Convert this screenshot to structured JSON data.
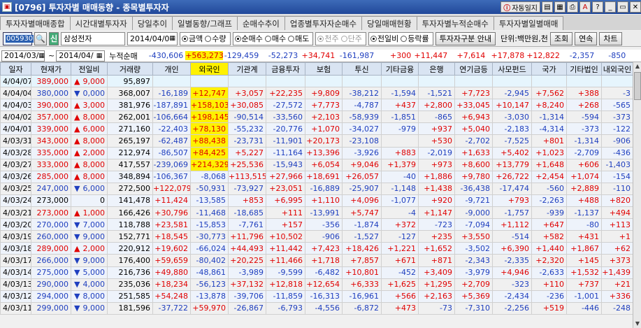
{
  "window": {
    "code": "[0796]",
    "title": "투자자별 매매동향 - 종목별투자자",
    "auto_log": "자동일지",
    "help": "?"
  },
  "tabs": [
    "투자자별매매종합",
    "시간대별투자자",
    "당일추이",
    "일별동향/그래프",
    "순매수추이",
    "업종별투자자순매수",
    "당일매매현황",
    "투자자별누적순매수",
    "투자자별일별매매"
  ],
  "toolbar": {
    "code": "005930",
    "stock_name": "삼성전자",
    "date": "2014/04/0",
    "r_amount": "금액",
    "r_qty": "수량",
    "r_net": "순매수",
    "r_buy": "매수",
    "r_sell": "매도",
    "r_thousand": "천주",
    "r_unit": "단주",
    "r_prevday": "전일비",
    "r_rate": "등락률",
    "investor_btn": "투자자구분 안내",
    "unit_label": "단위:백만원,천",
    "query": "조회",
    "next": "연속",
    "chart": "차트"
  },
  "summary": {
    "from": "2014/03/",
    "to": "2014/04/",
    "label": "누적순매",
    "values": [
      "-430,606",
      "+563,273",
      "-129,459",
      "-52,273",
      "+34,741",
      "-161,987",
      "+300",
      "+11,447",
      "+7,614",
      "+17,878",
      "+12,822",
      "-2,357",
      "-850"
    ]
  },
  "columns": [
    "일자",
    "현재가",
    "전일비",
    "거래량",
    "개인",
    "외국인",
    "기관계",
    "금융투자",
    "보험",
    "투신",
    "기타금융",
    "은행",
    "연기금등",
    "사모펀드",
    "국가",
    "기타법인",
    "내외국인"
  ],
  "rows": [
    [
      "4/04/07",
      "389,000",
      "9,000",
      "95,897",
      "",
      "",
      "",
      "",
      "",
      "",
      "",
      "",
      "",
      "",
      "",
      "",
      ""
    ],
    [
      "4/04/04",
      "380,000",
      "0,000",
      "368,007",
      "-16,189",
      "+12,747",
      "+3,057",
      "+22,235",
      "+9,809",
      "-38,212",
      "-1,594",
      "-1,521",
      "+7,723",
      "-2,945",
      "+7,562",
      "+388",
      "-3"
    ],
    [
      "4/04/03",
      "390,000",
      "3,000",
      "381,976",
      "-187,891",
      "+158,103",
      "+30,085",
      "-27,572",
      "+7,773",
      "-4,787",
      "+437",
      "+2,800",
      "+33,045",
      "+10,147",
      "+8,240",
      "+268",
      "-565"
    ],
    [
      "4/04/02",
      "357,000",
      "8,000",
      "262,001",
      "-106,664",
      "+198,145",
      "-90,514",
      "-33,560",
      "+2,103",
      "-58,939",
      "-1,851",
      "-865",
      "+6,943",
      "-3,030",
      "-1,314",
      "-594",
      "-373"
    ],
    [
      "4/04/01",
      "339,000",
      "6,000",
      "271,160",
      "-22,403",
      "+78,130",
      "-55,232",
      "-20,776",
      "+1,070",
      "-34,027",
      "-979",
      "+937",
      "+5,040",
      "-2,183",
      "-4,314",
      "-373",
      "-122"
    ],
    [
      "4/03/31",
      "343,000",
      "8,000",
      "265,197",
      "-62,487",
      "+88,438",
      "-23,731",
      "-11,901",
      "+20,173",
      "-23,108",
      "",
      "+530",
      "-2,702",
      "-7,525",
      "+801",
      "-1,314",
      "-906"
    ],
    [
      "4/03/28",
      "335,000",
      "2,000",
      "212,974",
      "-86,507",
      "+84,425",
      "+5,227",
      "-11,164",
      "+13,396",
      "-3,926",
      "+883",
      "-2,019",
      "+1,633",
      "+5,402",
      "+1,023",
      "-2,709",
      "-436"
    ],
    [
      "4/03/27",
      "333,000",
      "8,000",
      "417,557",
      "-239,069",
      "+214,329",
      "+25,536",
      "-15,943",
      "+6,054",
      "+9,046",
      "+1,379",
      "+973",
      "+8,600",
      "+13,779",
      "+1,648",
      "+606",
      "-1,403"
    ],
    [
      "4/03/26",
      "285,000",
      "8,000",
      "348,894",
      "-106,367",
      "-8,068",
      "+113,515",
      "+27,966",
      "+18,691",
      "+26,057",
      "-40",
      "+1,886",
      "+9,780",
      "+26,722",
      "+2,454",
      "+1,074",
      "-154"
    ],
    [
      "4/03/25",
      "247,000",
      "6,000",
      "272,500",
      "+122,079",
      "-50,931",
      "-73,927",
      "+23,051",
      "-16,889",
      "-25,907",
      "-1,148",
      "+1,438",
      "-36,438",
      "-17,474",
      "-560",
      "+2,889",
      "-110"
    ],
    [
      "4/03/24",
      "273,000",
      "0",
      "141,478",
      "+11,424",
      "-13,585",
      "+853",
      "+6,995",
      "+1,110",
      "+4,096",
      "-1,077",
      "+920",
      "-9,721",
      "+793",
      "-2,263",
      "+488",
      "+820"
    ],
    [
      "4/03/21",
      "273,000",
      "1,000",
      "166,426",
      "+30,796",
      "-11,468",
      "-18,685",
      "+111",
      "-13,991",
      "+5,747",
      "-4",
      "+1,147",
      "-9,000",
      "-1,757",
      "-939",
      "-1,137",
      "+494"
    ],
    [
      "4/03/20",
      "270,000",
      "7,000",
      "118,788",
      "+23,581",
      "-15,853",
      "-7,761",
      "+157",
      "-356",
      "-1,874",
      "+372",
      "-723",
      "-7,094",
      "+1,112",
      "+647",
      "-80",
      "+113"
    ],
    [
      "4/03/19",
      "260,000",
      "9,000",
      "152,771",
      "+18,545",
      "-30,773",
      "+11,796",
      "+10,502",
      "-906",
      "-1,527",
      "-127",
      "+235",
      "+3,550",
      "-514",
      "+582",
      "+431",
      "+1"
    ],
    [
      "4/03/18",
      "289,000",
      "2,000",
      "220,912",
      "+19,602",
      "-66,024",
      "+44,493",
      "+11,442",
      "+7,423",
      "+18,426",
      "+1,221",
      "+1,652",
      "-3,502",
      "+6,390",
      "+1,440",
      "+1,867",
      "+62"
    ],
    [
      "4/03/17",
      "266,000",
      "9,000",
      "176,400",
      "+59,659",
      "-80,402",
      "+20,225",
      "+11,466",
      "+1,718",
      "+7,857",
      "+671",
      "+871",
      "-2,343",
      "-2,335",
      "+2,320",
      "+145",
      "+373"
    ],
    [
      "4/03/14",
      "275,000",
      "5,000",
      "216,736",
      "+49,880",
      "-48,861",
      "-3,989",
      "-9,599",
      "-6,482",
      "+10,801",
      "-452",
      "+3,409",
      "-3,979",
      "+4,946",
      "-2,633",
      "+1,532",
      "+1,439"
    ],
    [
      "4/03/13",
      "290,000",
      "4,000",
      "235,036",
      "+18,234",
      "-56,123",
      "+37,132",
      "+12,818",
      "+12,654",
      "+6,333",
      "+1,625",
      "+1,295",
      "+2,709",
      "-323",
      "+110",
      "+737",
      "+21"
    ],
    [
      "4/03/12",
      "294,000",
      "8,000",
      "251,585",
      "+54,248",
      "-13,878",
      "-39,706",
      "-11,859",
      "-16,313",
      "-16,961",
      "+566",
      "+2,163",
      "+5,369",
      "-2,434",
      "-236",
      "-1,001",
      "+336"
    ],
    [
      "4/03/11",
      "299,000",
      "9,000",
      "181,596",
      "-37,722",
      "+59,970",
      "-26,867",
      "-6,793",
      "-4,556",
      "-6,872",
      "+473",
      "-73",
      "-7,310",
      "-2,256",
      "+519",
      "-446",
      "-248"
    ]
  ],
  "price_dir": [
    "up",
    "down",
    "up",
    "up",
    "up",
    "up",
    "up",
    "up",
    "up",
    "down",
    "none",
    "up",
    "down",
    "down",
    "up",
    "down",
    "down",
    "down",
    "down",
    "down"
  ],
  "colors": {
    "up": "#e00000",
    "down": "#1f3fbf",
    "highlight": "#fff100",
    "header": "#d9e4f2"
  }
}
